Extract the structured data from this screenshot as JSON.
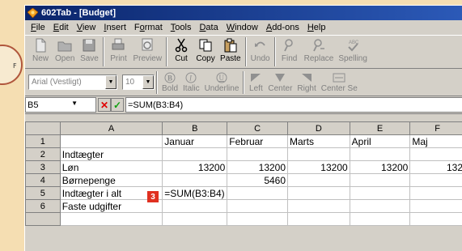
{
  "window": {
    "title": "602Tab - [Budget]"
  },
  "menu": [
    {
      "pre": "",
      "u": "F",
      "post": "ile"
    },
    {
      "pre": "",
      "u": "E",
      "post": "dit"
    },
    {
      "pre": "",
      "u": "V",
      "post": "iew"
    },
    {
      "pre": "",
      "u": "I",
      "post": "nsert"
    },
    {
      "pre": "F",
      "u": "o",
      "post": "rmat"
    },
    {
      "pre": "",
      "u": "T",
      "post": "ools"
    },
    {
      "pre": "",
      "u": "D",
      "post": "ata"
    },
    {
      "pre": "",
      "u": "W",
      "post": "indow"
    },
    {
      "pre": "",
      "u": "A",
      "post": "dd-ons"
    },
    {
      "pre": "",
      "u": "H",
      "post": "elp"
    }
  ],
  "toolbar": {
    "new": "New",
    "open": "Open",
    "save": "Save",
    "print": "Print",
    "preview": "Preview",
    "cut": "Cut",
    "copy": "Copy",
    "paste": "Paste",
    "undo": "Undo",
    "find": "Find",
    "replace": "Replace",
    "spelling": "Spelling"
  },
  "format": {
    "font": "Arial (Vestligt)",
    "size": "10",
    "bold": "Bold",
    "italic": "Italic",
    "underline": "Underline",
    "left": "Left",
    "center": "Center",
    "right": "Right",
    "center_sel": "Center Se"
  },
  "editbar": {
    "cellref": "B5",
    "formula": "=SUM(B3:B4)"
  },
  "sheet": {
    "columns": [
      "A",
      "B",
      "C",
      "D",
      "E",
      "F"
    ],
    "rows": [
      {
        "n": "1",
        "a": "",
        "b": "Januar",
        "c": "Februar",
        "d": "Marts",
        "e": "April",
        "f": "Maj"
      },
      {
        "n": "2",
        "a": "Indtægter",
        "b": "",
        "c": "",
        "d": "",
        "e": "",
        "f": ""
      },
      {
        "n": "3",
        "a": "Løn",
        "b": "13200",
        "c": "13200",
        "d": "13200",
        "e": "13200",
        "f": "132"
      },
      {
        "n": "4",
        "a": "Børnepenge",
        "b": "",
        "c": "5460",
        "d": "",
        "e": "",
        "f": ""
      },
      {
        "n": "5",
        "a": "Indtægter i alt",
        "b": "=SUM(B3:B4)",
        "c": "",
        "d": "",
        "e": "",
        "f": ""
      },
      {
        "n": "6",
        "a": "Faste udgifter",
        "b": "",
        "c": "",
        "d": "",
        "e": "",
        "f": ""
      }
    ],
    "step_badge": "3"
  }
}
